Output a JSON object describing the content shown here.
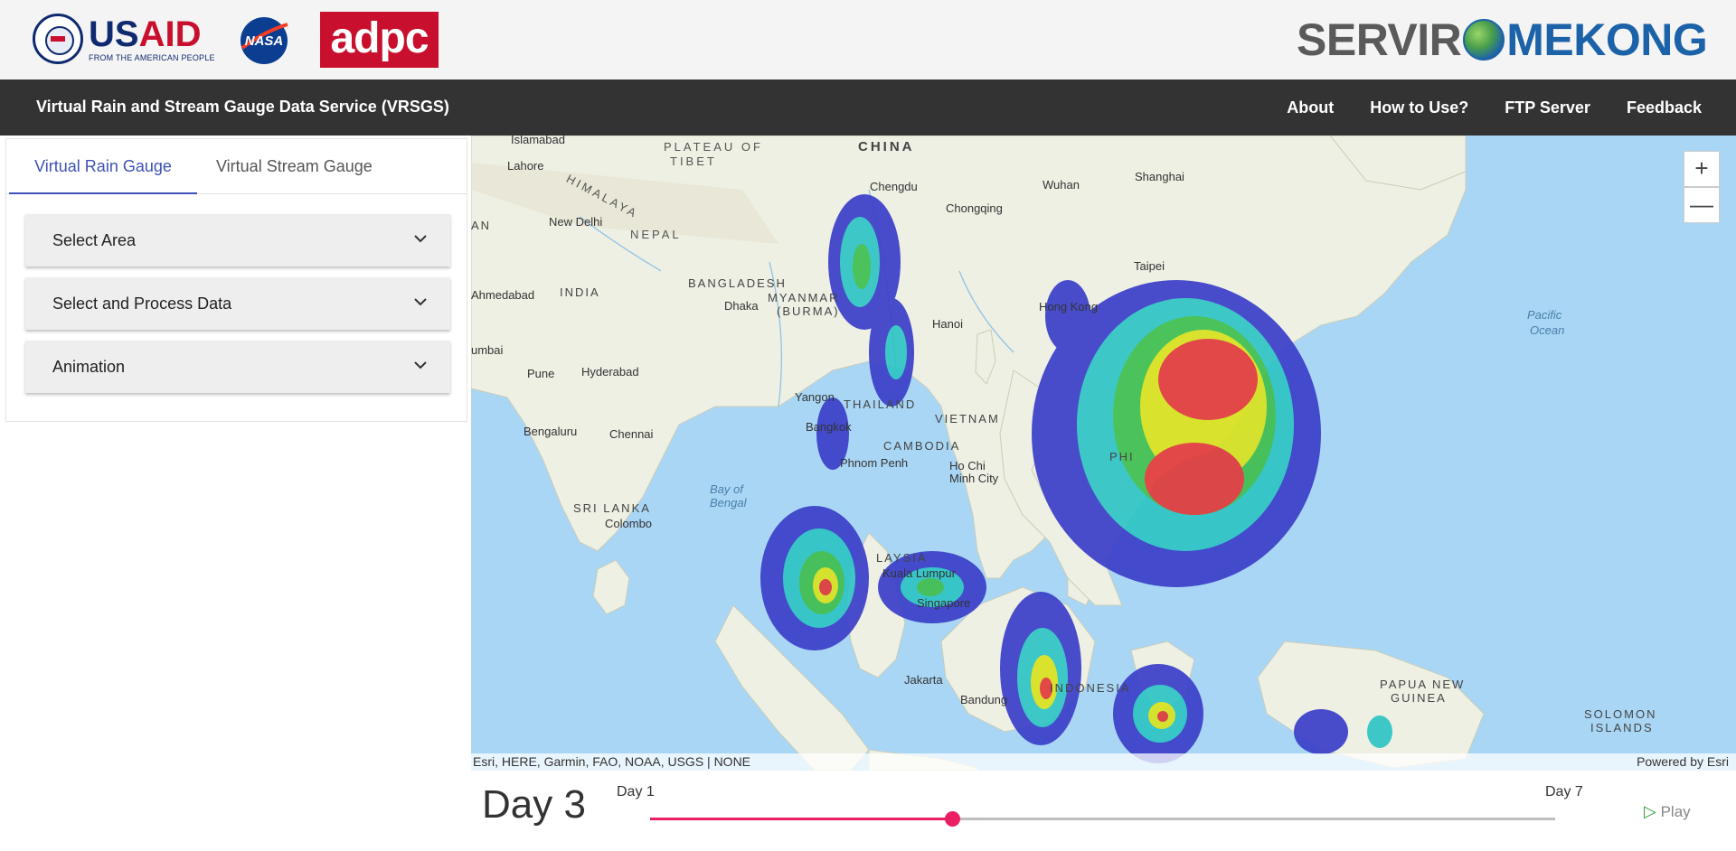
{
  "header": {
    "usaid_main": "USAID",
    "usaid_sub": "FROM THE AMERICAN PEOPLE",
    "adpc_text": "adpc",
    "servir_left": "SERVIR",
    "servir_right": "MEKONG"
  },
  "nav": {
    "title": "Virtual Rain and Stream Gauge Data Service (VRSGS)",
    "links": [
      "About",
      "How to Use?",
      "FTP Server",
      "Feedback"
    ]
  },
  "sidebar": {
    "tabs": [
      "Virtual Rain Gauge",
      "Virtual Stream Gauge"
    ],
    "active_tab": "Virtual Rain Gauge",
    "accordions": [
      "Select Area",
      "Select and Process Data",
      "Animation"
    ]
  },
  "map": {
    "labels": {
      "islamabad": "Islamabad",
      "lahore": "Lahore",
      "new_delhi": "New Delhi",
      "nepal": "NEPAL",
      "plateau": "PLATEAU OF",
      "tibet": "TIBET",
      "china": "CHINA",
      "himalaya": "HIMALAYA",
      "chengdu": "Chengdu",
      "chongqing": "Chongqing",
      "wuhan": "Wuhan",
      "shanghai": "Shanghai",
      "taipei": "Taipei",
      "hong_kong": "Hong Kong",
      "hanoi": "Hanoi",
      "bangladesh": "BANGLADESH",
      "dhaka": "Dhaka",
      "myanmar": "MYANMAR",
      "burma": "(BURMA)",
      "india": "INDIA",
      "ahmedabad": "Ahmedabad",
      "mumbai": "umbai",
      "pune": "Pune",
      "hyderabad": "Hyderabad",
      "bengaluru": "Bengaluru",
      "chennai": "Chennai",
      "sri_lanka": "SRI LANKA",
      "colombo": "Colombo",
      "yangon": "Yangon",
      "thailand": "THAILAND",
      "bangkok": "Bangkok",
      "vietnam": "VIETNAM",
      "cambodia": "CAMBODIA",
      "phnom_penh": "Phnom Penh",
      "ho_chi_minh": "Ho Chi",
      "ho_chi_minh2": "Minh City",
      "bay_bengal": "Bay of",
      "bay_bengal2": "Bengal",
      "pacific": "Pacific",
      "pacific2": "Ocean",
      "kuala_lumpur": "Kuala Lumpur",
      "singapore": "Singapore",
      "jakarta": "Jakarta",
      "bandung": "Bandung",
      "indonesia": "INDONESIA",
      "papua": "PAPUA NEW",
      "guinea": "GUINEA",
      "solomon": "SOLOMON",
      "islands": "ISLANDS",
      "an_edge": "AN",
      "malaysia": "LAYSIA",
      "phil": "PHI"
    },
    "zoom_in": "+",
    "zoom_out": "—",
    "attribution_left": "Esri, HERE, Garmin, FAO, NOAA, USGS | NONE",
    "attribution_right": "Powered by Esri"
  },
  "timeline": {
    "current_label": "Day 3",
    "min_label": "Day 1",
    "max_label": "Day 7",
    "current": 3,
    "min": 1,
    "max": 7,
    "play_label": "Play"
  },
  "colors": {
    "accent": "#e91e63",
    "tab_active": "#3f51b5",
    "navbar": "#333333",
    "rain_low": "#3b3fc8",
    "rain_mid": "#2ec4c4",
    "rain_high": "#d8e21e",
    "rain_max": "#e03a3a"
  }
}
